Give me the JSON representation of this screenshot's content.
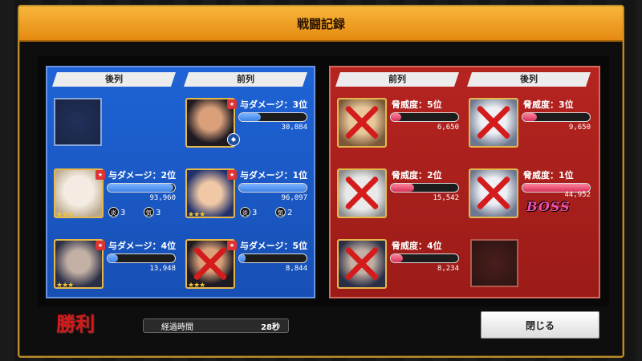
{
  "title": "戦闘記録",
  "ally": {
    "col_back": "後列",
    "col_front": "前列",
    "units": [
      {
        "slot": "front-top",
        "label": "与ダメージ：3位",
        "value": "30,884",
        "ratio": 0.32,
        "xed": false
      },
      {
        "slot": "back-mid",
        "label": "与ダメージ：2位",
        "value": "93,960",
        "ratio": 0.98,
        "xed": false,
        "fire": "3",
        "ki": "3"
      },
      {
        "slot": "front-mid",
        "label": "与ダメージ：1位",
        "value": "96,097",
        "ratio": 1.0,
        "xed": false,
        "fire": "3",
        "ki": "2"
      },
      {
        "slot": "back-bot",
        "label": "与ダメージ：4位",
        "value": "13,948",
        "ratio": 0.15,
        "xed": false
      },
      {
        "slot": "front-bot",
        "label": "与ダメージ：5位",
        "value": "8,844",
        "ratio": 0.09,
        "xed": true
      }
    ],
    "fire_icon": "炎",
    "ki_icon": "気"
  },
  "enemy": {
    "col_front": "前列",
    "col_back": "後列",
    "units": [
      {
        "slot": "front-top",
        "label": "脅威度：5位",
        "value": "6,650",
        "ratio": 0.15
      },
      {
        "slot": "back-top",
        "label": "脅威度：3位",
        "value": "9,650",
        "ratio": 0.21
      },
      {
        "slot": "front-mid",
        "label": "脅威度：2位",
        "value": "15,542",
        "ratio": 0.35
      },
      {
        "slot": "back-mid",
        "label": "脅威度：1位",
        "value": "44,952",
        "ratio": 1.0
      },
      {
        "slot": "front-bot",
        "label": "脅威度：4位",
        "value": "8,234",
        "ratio": 0.18
      }
    ],
    "boss_label": "BOSS"
  },
  "footer": {
    "victory": "勝利",
    "time_label": "経過時間",
    "time_value": "28秒",
    "close_button": "閉じる"
  }
}
